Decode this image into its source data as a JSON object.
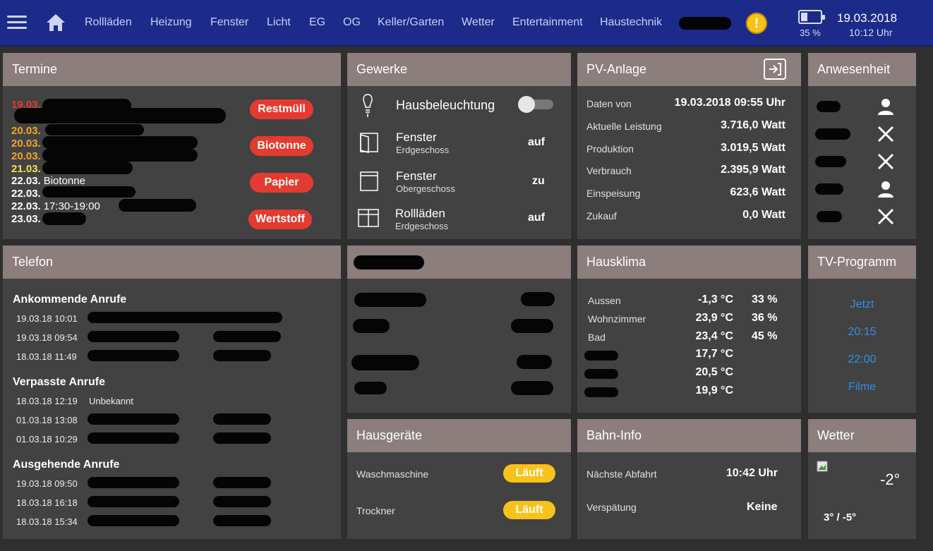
{
  "nav": {
    "items": [
      "Rollläden",
      "Heizung",
      "Fenster",
      "Licht",
      "EG",
      "OG",
      "Keller/Garten",
      "Wetter",
      "Entertainment",
      "Haustechnik"
    ],
    "battery_percent": "35 %",
    "battery_level": 0.35,
    "date": "19.03.2018",
    "time": "10:12 Uhr",
    "warning_symbol": "!",
    "icons": [
      "menu-icon",
      "home-icon",
      "warning-icon",
      "battery-icon"
    ]
  },
  "termine": {
    "title": "Termine",
    "entries": [
      {
        "date": "19.03.",
        "text": "",
        "color": "#e53a2f"
      },
      {
        "date": "20.03.",
        "text": "",
        "color": "#f3a623"
      },
      {
        "date": "20.03.",
        "text": "",
        "color": "#f3a623"
      },
      {
        "date": "20.03.",
        "text": "",
        "color": "#f3a623"
      },
      {
        "date": "21.03.",
        "text": "",
        "color": "#f7e24a"
      },
      {
        "date": "22.03.",
        "text": "Biotonne",
        "color": "#ffffff"
      },
      {
        "date": "22.03.",
        "text": "",
        "color": "#ffffff"
      },
      {
        "date": "22.03.",
        "text": "17:30-19:00",
        "color": "#ffffff"
      },
      {
        "date": "23.03.",
        "text": "",
        "color": "#ffffff"
      }
    ],
    "badges": [
      "Restmüll",
      "Biotonne",
      "Papier",
      "Wertstoff"
    ]
  },
  "gewerke": {
    "title": "Gewerke",
    "light_label": "Hausbeleuchtung",
    "light_on": false,
    "rows": [
      {
        "label": "Fenster",
        "sub": "Erdgeschoss",
        "value": "auf"
      },
      {
        "label": "Fenster",
        "sub": "Obergeschoss",
        "value": "zu"
      },
      {
        "label": "Rollläden",
        "sub": "Erdgeschoss",
        "value": "auf"
      }
    ]
  },
  "pv": {
    "title": "PV-Anlage",
    "rows": [
      {
        "label": "Daten von",
        "value": "19.03.2018 09:55 Uhr"
      },
      {
        "label": "Aktuelle Leistung",
        "value": "3.716,0 Watt"
      },
      {
        "label": "Produktion",
        "value": "3.019,5 Watt"
      },
      {
        "label": "Verbrauch",
        "value": "2.395,9 Watt"
      },
      {
        "label": "Einspeisung",
        "value": "623,6 Watt"
      },
      {
        "label": "Zukauf",
        "value": "0,0 Watt"
      }
    ]
  },
  "anwesenheit": {
    "title": "Anwesenheit",
    "status": [
      "present",
      "absent",
      "absent",
      "present",
      "absent"
    ]
  },
  "telefon": {
    "title": "Telefon",
    "sections": [
      {
        "title": "Ankommende Anrufe",
        "calls": [
          {
            "time": "19.03.18 10:01",
            "name": ""
          },
          {
            "time": "19.03.18 09:54",
            "name": ""
          },
          {
            "time": "18.03.18 11:49",
            "name": ""
          }
        ]
      },
      {
        "title": "Verpasste Anrufe",
        "calls": [
          {
            "time": "18.03.18 12:19",
            "name": "Unbekannt"
          },
          {
            "time": "01.03.18 13:08",
            "name": ""
          },
          {
            "time": "01.03.18 10:29",
            "name": ""
          }
        ]
      },
      {
        "title": "Ausgehende Anrufe",
        "calls": [
          {
            "time": "19.03.18 09:50",
            "name": ""
          },
          {
            "time": "18.03.18 16:18",
            "name": ""
          },
          {
            "time": "18.03.18 15:34",
            "name": ""
          }
        ]
      }
    ]
  },
  "hausklima": {
    "title": "Hausklima",
    "rows": [
      {
        "label": "Aussen",
        "temp": "-1,3 °C",
        "humidity": "33 %"
      },
      {
        "label": "Wohnzimmer",
        "temp": "23,9 °C",
        "humidity": "36 %"
      },
      {
        "label": "Bad",
        "temp": "23,4 °C",
        "humidity": "45 %"
      },
      {
        "label": "",
        "temp": "17,7 °C",
        "humidity": ""
      },
      {
        "label": "",
        "temp": "20,5 °C",
        "humidity": ""
      },
      {
        "label": "",
        "temp": "19,9 °C",
        "humidity": ""
      }
    ]
  },
  "tv": {
    "title": "TV-Programm",
    "links": [
      "Jetzt",
      "20:15",
      "22:00",
      "Filme"
    ]
  },
  "hausgeraete": {
    "title": "Hausgeräte",
    "rows": [
      {
        "label": "Waschmaschine",
        "status": "Läuft"
      },
      {
        "label": "Trockner",
        "status": "Läuft"
      }
    ]
  },
  "bahn": {
    "title": "Bahn-Info",
    "rows": [
      {
        "label": "Nächste Abfahrt",
        "value": "10:42 Uhr"
      },
      {
        "label": "Verspätung",
        "value": "Keine"
      }
    ]
  },
  "wetter": {
    "title": "Wetter",
    "temp": "-2°",
    "range": "3° / -5°"
  },
  "colors": {
    "topbar": "#1c2a8a",
    "panel_header": "#8b7e7c",
    "panel_body": "#424242",
    "accent_red": "#e53a2f",
    "accent_yellow": "#f7c21a",
    "link_blue": "#2f8fe6"
  }
}
